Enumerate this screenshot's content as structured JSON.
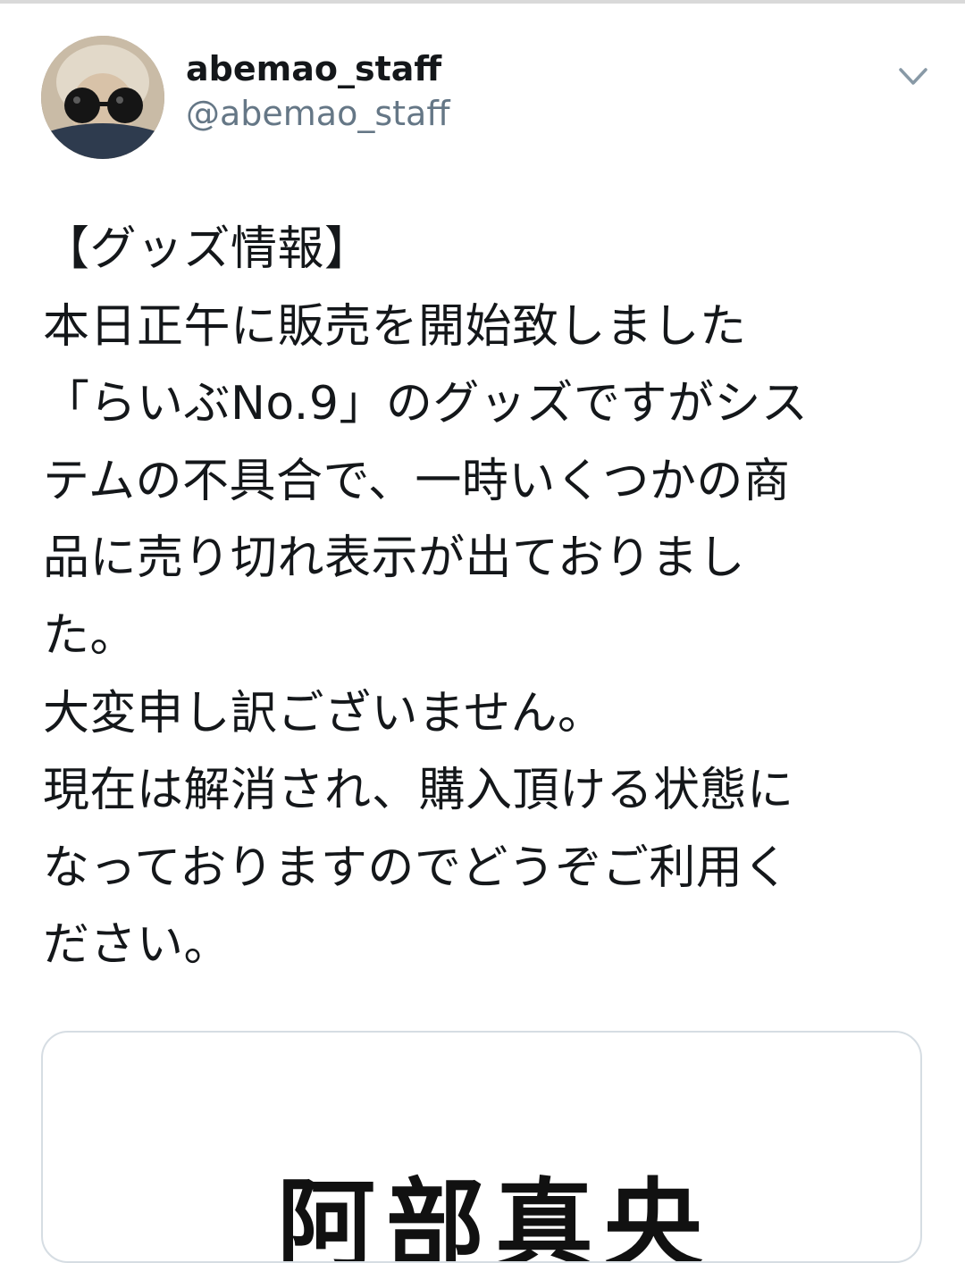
{
  "tweet": {
    "author": {
      "display_name": "abemao_staff",
      "handle": "@abemao_staff"
    },
    "menu_icon": "chevron-down-icon",
    "lines": [
      "【グッズ情報】",
      "本日正午に販売を開始致しました",
      "「らいぶNo.9」のグッズですがシス",
      "テムの不具合で、一時いくつかの商",
      "品に売り切れ表示が出ておりまし",
      "た。",
      "大変申し訳ございません。",
      "現在は解消され、購入頂ける状態に",
      "なっておりますのでどうぞご利用く",
      "ださい。"
    ],
    "card": {
      "title": "阿部真央"
    }
  },
  "colors": {
    "text": "#14171a",
    "secondary_text": "#657786",
    "card_border": "#d6dde3",
    "chevron": "#8899a6"
  }
}
